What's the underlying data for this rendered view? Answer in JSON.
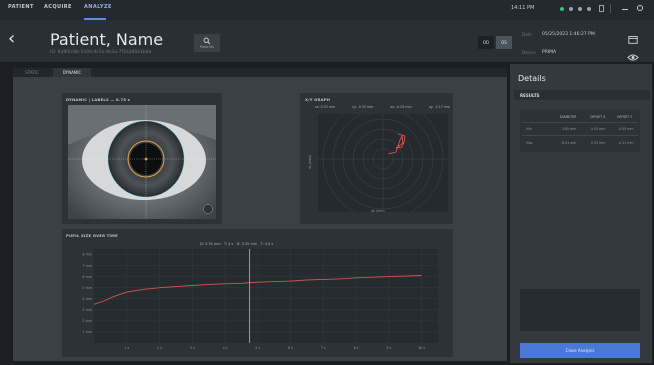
{
  "nav": {
    "patient": "PATIENT",
    "acquire": "ACQUIRE",
    "analyze": "ANALYZE"
  },
  "status": {
    "clock": "14:11 PM"
  },
  "patient": {
    "name": "Patient, Name",
    "id": "ID: 8a9f2c8b-5a0d-4c1e-9c3a-7f2a2d0e1b4a"
  },
  "search": {
    "label": "Patients"
  },
  "eye_toggle": {
    "od": "OD",
    "os": "OS"
  },
  "meta": {
    "date_label": "Date",
    "date_value": "05/25/2023 1:46:27 PM",
    "device_label": "Device",
    "device_value": "PRIMA"
  },
  "tabs": {
    "static": "STATIC",
    "dynamic": "DYNAMIC"
  },
  "eye_card": {
    "title": "DYNAMIC | LABELS — 8.75 s",
    "timestamp": "8.75 s"
  },
  "xy_card": {
    "title": "X/Y GRAPH",
    "readouts": [
      "sx: 0.03 mm",
      "sy: -0.33 mm",
      "ax: -0.05 mm",
      "ay: -0.17 mm"
    ],
    "xlabel": "dx (mm)",
    "ylabel": "dy (mm)"
  },
  "pupil_chart": {
    "title": "PUPIL SIZE OVER TIME",
    "cursor_readout": "D: 3.35 mm   T: 4 s   D: 3.35 mm   T: 4.0 s",
    "cursor_time": 4.75,
    "y_ticks": [
      "1 mm",
      "2 mm",
      "3 mm",
      "4 mm",
      "5 mm",
      "6 mm",
      "7 mm",
      "8 mm"
    ],
    "x_ticks": [
      "1 s",
      "2 s",
      "3 s",
      "4 s",
      "5 s",
      "6 s",
      "7 s",
      "8 s",
      "9 s",
      "10 s"
    ]
  },
  "chart_data": {
    "type": "line",
    "title": "PUPIL SIZE OVER TIME",
    "xlabel": "",
    "ylabel": "",
    "xlim": [
      0,
      10.5
    ],
    "ylim": [
      0,
      8.5
    ],
    "series": [
      {
        "color": "#d9534f",
        "x": [
          0,
          0.3,
          0.6,
          1,
          1.5,
          2,
          2.5,
          3,
          3.5,
          4,
          4.5,
          5,
          5.5,
          6,
          6.5,
          7,
          7.5,
          8,
          8.5,
          9,
          9.5,
          10
        ],
        "y": [
          3.5,
          3.8,
          4.2,
          4.6,
          4.85,
          5.0,
          5.1,
          5.2,
          5.3,
          5.35,
          5.4,
          5.5,
          5.55,
          5.6,
          5.7,
          5.75,
          5.8,
          5.9,
          5.95,
          6.0,
          6.05,
          6.1
        ]
      }
    ],
    "grid": true
  },
  "details": {
    "title": "Details",
    "results_label": "RESULTS",
    "columns": [
      "",
      "DIAMETER",
      "OFFSET X",
      "OFFSET Y"
    ],
    "rows": [
      [
        "Min",
        "3.85 mm",
        "0.05 mm",
        "-0.05 mm"
      ],
      [
        "Max",
        "6.01 mm",
        "0.33 mm",
        "-0.11 mm"
      ]
    ],
    "close_label": "Close Analysis"
  }
}
